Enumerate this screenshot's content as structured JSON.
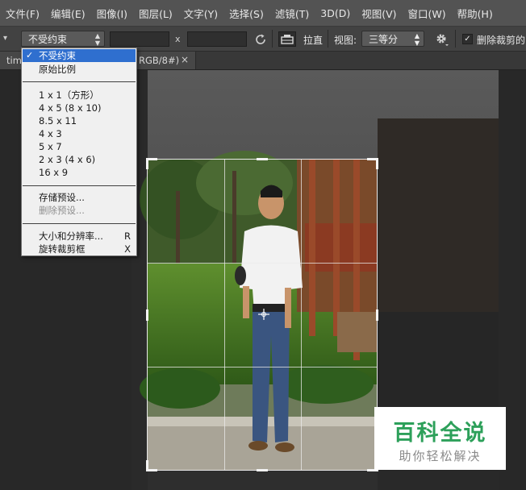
{
  "menubar": {
    "items": [
      "文件(F)",
      "编辑(E)",
      "图像(I)",
      "图层(L)",
      "文字(Y)",
      "选择(S)",
      "滤镜(T)",
      "3D(D)",
      "视图(V)",
      "窗口(W)",
      "帮助(H)"
    ]
  },
  "options": {
    "ratio_value": "不受约束",
    "x_label": "x",
    "straighten_label": "拉直",
    "view_label": "视图:",
    "view_value": "三等分",
    "delete_label": "删除裁剪的",
    "delete_checked": "✓"
  },
  "tab": {
    "left_text": "tim",
    "right_text": "RGB/8#)",
    "close": "×"
  },
  "dropdown": {
    "check": "✓",
    "items": [
      {
        "label": "不受约束",
        "shortcut": ""
      },
      {
        "label": "原始比例",
        "shortcut": ""
      },
      {
        "label": "1 x 1（方形）",
        "shortcut": ""
      },
      {
        "label": "4 x 5 (8 x 10)",
        "shortcut": ""
      },
      {
        "label": "8.5 x 11",
        "shortcut": ""
      },
      {
        "label": "4 x 3",
        "shortcut": ""
      },
      {
        "label": "5 x 7",
        "shortcut": ""
      },
      {
        "label": "2 x 3 (4 x 6)",
        "shortcut": ""
      },
      {
        "label": "16 x 9",
        "shortcut": ""
      },
      {
        "label": "存储预设...",
        "shortcut": ""
      },
      {
        "label": "删除预设...",
        "shortcut": ""
      },
      {
        "label": "大小和分辨率...",
        "shortcut": "R"
      },
      {
        "label": "旋转裁剪框",
        "shortcut": "X"
      }
    ]
  },
  "watermark": {
    "title": "百科全说",
    "subtitle": "助你轻松解决"
  },
  "colors": {
    "menubar_bg": "#535353",
    "options_bg": "#424242",
    "canvas_bg": "#282828",
    "selection": "#2f6fcf",
    "watermark_green": "#2da05a"
  }
}
